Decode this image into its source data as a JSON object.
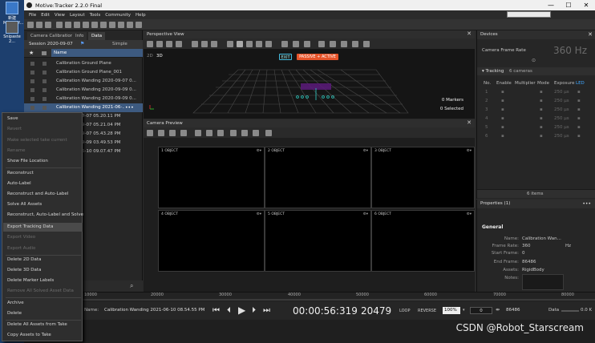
{
  "desktop": {
    "icons": [
      {
        "label": "新建 Microsof..."
      },
      {
        "label": "Snipaste 2..."
      }
    ]
  },
  "window": {
    "title": "Motive:Tracker 2.2.0 Final",
    "min": "—",
    "max": "☐",
    "close": "✕"
  },
  "menu": [
    "File",
    "Edit",
    "View",
    "Layout",
    "Tools",
    "Community",
    "Help"
  ],
  "left_panel": {
    "tabs": [
      "Camera Calibration",
      "Info",
      "Data"
    ],
    "session": "Session 2020-09-07",
    "view_mode": "Simple",
    "column_name": "Name",
    "takes": [
      "Calibration Ground Plane",
      "Calibration Ground Plane_001",
      "Calibration Wanding 2020-09-07 0...",
      "Calibration Wanding 2020-09-09 0...",
      "Calibration Wanding 2020-09-09 0...",
      "Calibration Wanding 2021-06-..."
    ],
    "dates": [
      "9-07 05.20.11 PM",
      "9-07 05.21.04 PM",
      "9-07 05.43.28 PM",
      "9-09 03.49.53 PM",
      "6-10 09.07.47 PM"
    ]
  },
  "context_menu": {
    "items": [
      {
        "label": "Save",
        "enabled": true
      },
      {
        "label": "Revert",
        "enabled": false
      },
      {
        "label": "Make selected take current",
        "enabled": false
      },
      {
        "label": "Rename",
        "enabled": false
      },
      {
        "label": "Show File Location",
        "enabled": true
      },
      {
        "label": "Reconstruct",
        "enabled": true
      },
      {
        "label": "Auto-Label",
        "enabled": true
      },
      {
        "label": "Reconstruct and Auto-Label",
        "enabled": true
      },
      {
        "label": "Solve All Assets",
        "enabled": true
      },
      {
        "label": "Reconstruct, Auto-Label and Solve",
        "enabled": true
      },
      {
        "label": "Export Tracking Data",
        "enabled": true
      },
      {
        "label": "Export Video",
        "enabled": false
      },
      {
        "label": "Export Audio",
        "enabled": false
      },
      {
        "label": "Delete 2D Data",
        "enabled": true
      },
      {
        "label": "Delete 3D Data",
        "enabled": true
      },
      {
        "label": "Delete Marker Labels",
        "enabled": true
      },
      {
        "label": "Remove All Solved Asset Data",
        "enabled": false
      },
      {
        "label": "Archive",
        "enabled": true
      },
      {
        "label": "Delete",
        "enabled": true
      },
      {
        "label": "Delete All Assets from Take",
        "enabled": true
      },
      {
        "label": "Copy Assets to Take",
        "enabled": true
      }
    ]
  },
  "perspective": {
    "title": "Perspective View",
    "mode_2d": "2D",
    "mode_3d": "3D",
    "exit_label": "EXIT",
    "status_label": "PASSIVE + ACTIVE",
    "markers": "0 Markers",
    "selected": "0 Selected",
    "status_color": "#e8542a"
  },
  "camera_preview": {
    "title": "Camera Preview",
    "cells": [
      {
        "num": "1",
        "mode": "OBJECT"
      },
      {
        "num": "2",
        "mode": "OBJECT"
      },
      {
        "num": "3",
        "mode": "OBJECT"
      },
      {
        "num": "4",
        "mode": "OBJECT"
      },
      {
        "num": "5",
        "mode": "OBJECT"
      },
      {
        "num": "6",
        "mode": "OBJECT"
      }
    ]
  },
  "devices": {
    "title": "Devices",
    "frame_rate_label": "Camera Frame Rate",
    "frame_rate_value": "360 Hz",
    "tracking_label": "Tracking",
    "tracking_count": "6 cameras",
    "columns": [
      "No.",
      "Enable",
      "Multiplier",
      "Mode",
      "Exposure",
      "LED"
    ],
    "rows": [
      {
        "no": "1",
        "exposure": "250 µs"
      },
      {
        "no": "2",
        "exposure": "250 µs"
      },
      {
        "no": "3",
        "exposure": "250 µs"
      },
      {
        "no": "4",
        "exposure": "250 µs"
      },
      {
        "no": "5",
        "exposure": "250 µs"
      },
      {
        "no": "6",
        "exposure": "250 µs"
      }
    ],
    "items_count": "6 items"
  },
  "properties": {
    "title": "Properties (1)",
    "section": "General",
    "fields": [
      {
        "key": "Name:",
        "value": "Calibration Wan..."
      },
      {
        "key": "Frame Rate:",
        "value": "360"
      },
      {
        "key": "Start Frame:",
        "value": "0"
      },
      {
        "key": "End Frame:",
        "value": "86486"
      },
      {
        "key": "Assets:",
        "value": "RigidBody"
      },
      {
        "key": "Notes:",
        "value": ""
      }
    ],
    "unit": "Hz"
  },
  "timeline": {
    "ticks": [
      "10000",
      "20000",
      "30000",
      "40000",
      "50000",
      "60000",
      "70000",
      "80000"
    ]
  },
  "transport": {
    "name_label": "Name:",
    "take_name": "Calibration Wanding 2021-06-10 08.54.55 PM",
    "timecode": "00:00:56:319",
    "frame": "20479",
    "loop_label": "LOOP",
    "reverse_label": "REVERSE",
    "speed": "100%",
    "start_frame": "0",
    "end_frame": "86486",
    "data_label": "Data",
    "data_rate": "0.0 K"
  },
  "watermark": "CSDN @Robot_Starscream"
}
